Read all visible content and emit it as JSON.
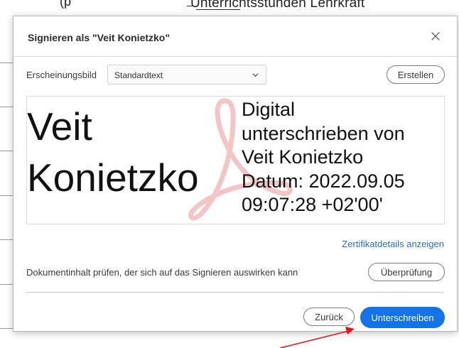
{
  "background": {
    "fragment": "(p",
    "partial_text": "Unterrichtsstunden Lehrkraft"
  },
  "dialog": {
    "title": "Signieren als \"Veit Konietzko\"",
    "appearance_label": "Erscheinungsbild",
    "appearance_select": "Standardtext",
    "create_button": "Erstellen",
    "signature_name": "Veit\nKonietzko",
    "signature_details": "Digital\nunterschrieben von\nVeit Konietzko\nDatum: 2022.09.05\n09:07:28 +02'00'",
    "certificate_link": "Zertifikatdetails anzeigen",
    "review_text": "Dokumentinhalt prüfen, der sich auf das Signieren auswirken kann",
    "review_button": "Überprüfung",
    "back_button": "Zurück",
    "sign_button": "Unterschreiben"
  },
  "colors": {
    "primary": "#1473e6",
    "link": "#2a6fc0",
    "annotation_arrow": "#e8141c"
  },
  "icons": [
    "close-icon",
    "chevron-down-icon",
    "acrobat-logo-icon",
    "annotation-arrow-icon"
  ]
}
